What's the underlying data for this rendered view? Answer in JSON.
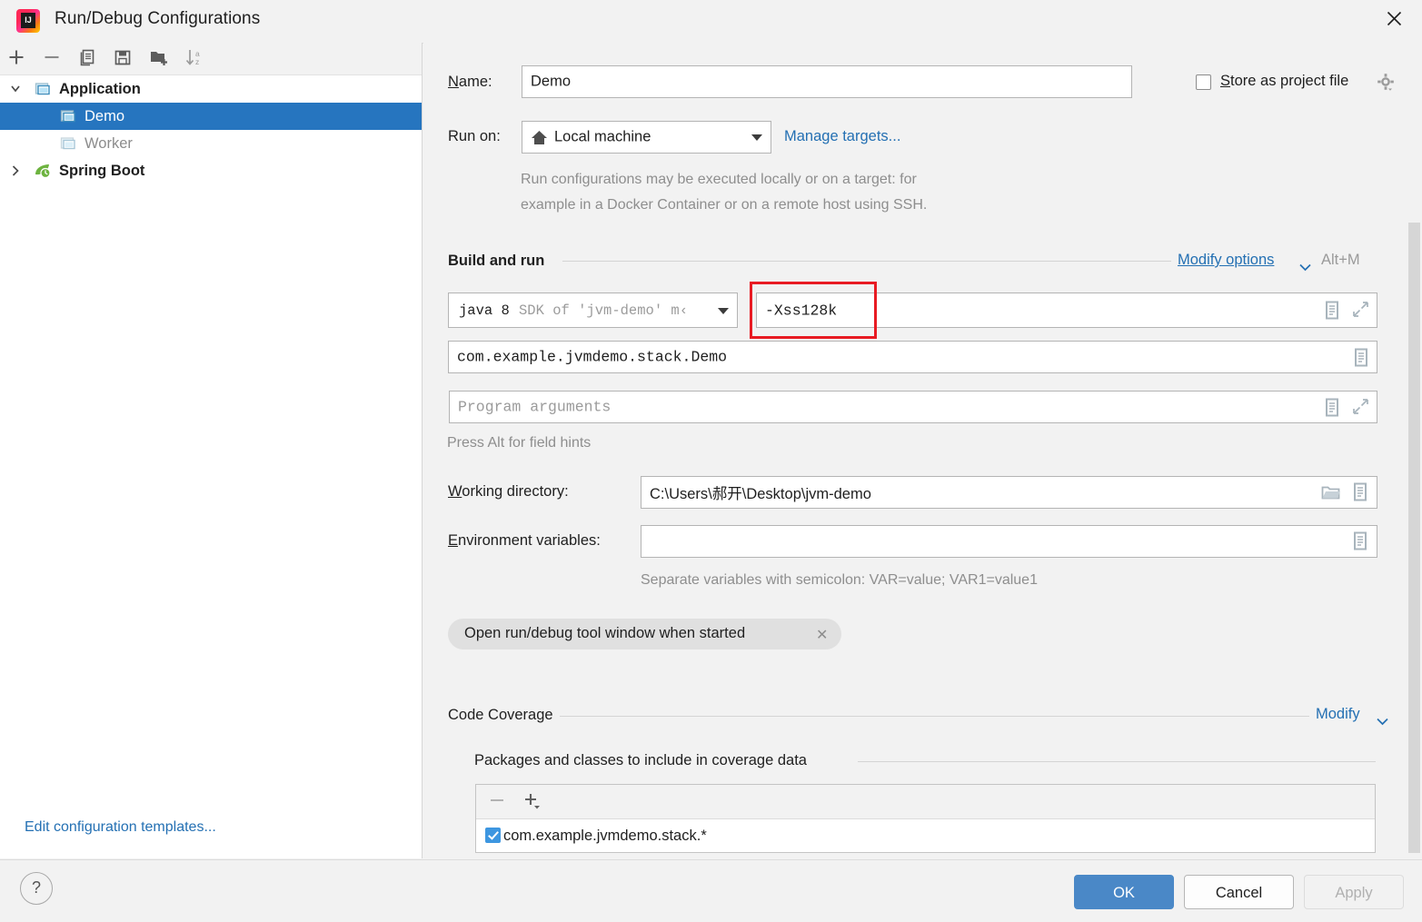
{
  "window": {
    "title": "Run/Debug Configurations",
    "logo_icon": "intellij-idea-logo",
    "close_icon": "close-icon"
  },
  "sidebar": {
    "toolbar": [
      {
        "name": "add-configuration-button",
        "icon": "plus-icon",
        "label": "+"
      },
      {
        "name": "remove-configuration-button",
        "icon": "minus-icon",
        "label": "−"
      },
      {
        "name": "copy-configuration-button",
        "icon": "copy-icon",
        "label": "Copy"
      },
      {
        "name": "save-configuration-button",
        "icon": "save-icon",
        "label": "Save"
      },
      {
        "name": "new-folder-button",
        "icon": "new-folder-icon",
        "label": "New Folder"
      },
      {
        "name": "sort-configurations-button",
        "icon": "sort-alphabetically-icon",
        "label": "Sort"
      }
    ],
    "tree": [
      {
        "label": "Application",
        "level": 0,
        "expanded": true,
        "icon": "application-icon",
        "state": "normal"
      },
      {
        "label": "Demo",
        "level": 1,
        "expanded": null,
        "icon": "application-icon",
        "state": "selected"
      },
      {
        "label": "Worker",
        "level": 1,
        "expanded": null,
        "icon": "application-icon",
        "state": "disabled"
      },
      {
        "label": "Spring Boot",
        "level": 0,
        "expanded": false,
        "icon": "spring-boot-icon",
        "state": "normal"
      }
    ],
    "edit_templates_link": "Edit configuration templates..."
  },
  "form": {
    "name_label": "Name:",
    "name_value": "Demo",
    "store_as_project_file_label": "Store as project file",
    "store_as_project_file_checked": false,
    "store_gear_icon": "gear-icon",
    "run_on_label": "Run on:",
    "run_on_value": "Local machine",
    "run_on_icon": "home-icon",
    "manage_targets_link": "Manage targets...",
    "run_on_description_line1": "Run configurations may be executed locally or on a target: for",
    "run_on_description_line2": "example in a Docker Container or on a remote host using SSH."
  },
  "build_and_run": {
    "section_title": "Build and run",
    "modify_options_link": "Modify options",
    "modify_options_shortcut": "Alt+M",
    "jdk_value_primary": "java 8",
    "jdk_value_secondary": "SDK of 'jvm-demo' m‹",
    "vm_options_value": "-Xss128k",
    "main_class_value": "com.example.jvmdemo.stack.Demo",
    "program_arguments_placeholder": "Program arguments",
    "field_hint": "Press Alt for field hints",
    "working_directory_label": "Working directory:",
    "working_directory_value": "C:\\Users\\郝开\\Desktop\\jvm-demo",
    "environment_variables_label": "Environment variables:",
    "environment_variables_value": "",
    "environment_variables_hint": "Separate variables with semicolon: VAR=value; VAR1=value1",
    "chip_label": "Open run/debug tool window when started",
    "chip_close_icon": "close-icon",
    "icons": {
      "macro_icon": "insert-macro-icon",
      "expand_icon": "expand-editor-icon",
      "browse_icon": "browse-folder-icon"
    },
    "annotation": {
      "highlight_color": "#e81b23",
      "highlight_target": "vm-options-field"
    }
  },
  "code_coverage": {
    "section_title": "Code Coverage",
    "modify_link": "Modify",
    "packages_title": "Packages and classes to include in coverage data",
    "toolbar": [
      {
        "name": "remove-package-button",
        "icon": "minus-icon",
        "enabled": false
      },
      {
        "name": "add-package-button",
        "icon": "plus-dropdown-icon",
        "enabled": true
      }
    ],
    "items": [
      {
        "label": "com.example.jvmdemo.stack.*",
        "checked": true
      }
    ]
  },
  "footer": {
    "help_label": "?",
    "ok_label": "OK",
    "cancel_label": "Cancel",
    "apply_label": "Apply",
    "apply_enabled": false
  },
  "colors": {
    "accent_blue": "#2470b3",
    "selection_blue": "#2675bf",
    "primary_button": "#4a88c7",
    "annotation_red": "#e81b23"
  }
}
